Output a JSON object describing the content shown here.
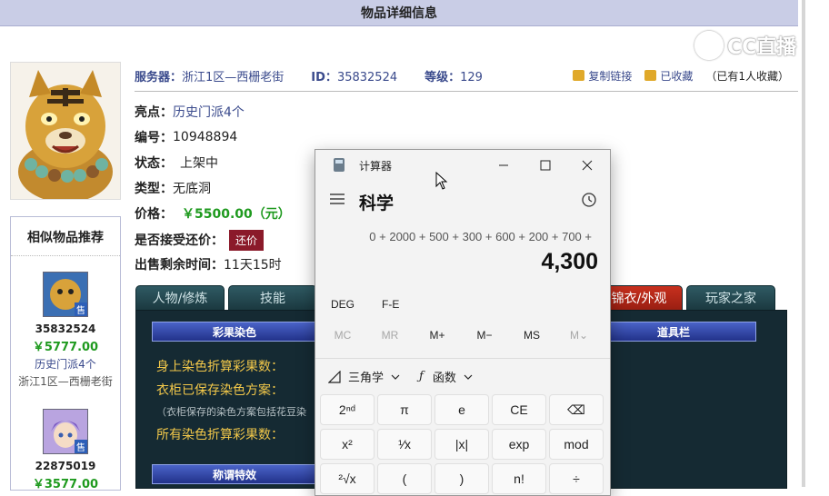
{
  "page": {
    "header_title": "物品详细信息",
    "watermark": "CC直播",
    "info_bar": {
      "server_label": "服务器：",
      "server_value": "浙江1区—西栅老街",
      "id_label": "ID：",
      "id_value": "35832524",
      "level_label": "等级：",
      "level_value": "129",
      "copy_link": "复制链接",
      "favorited": "已收藏",
      "favorite_count": "（已有1人收藏）"
    },
    "details": {
      "highlight_label": "亮点：",
      "highlight_value": "历史门派4个",
      "number_label": "编号：",
      "number_value": "10948894",
      "status_label": "状态：",
      "status_value": "上架中",
      "type_label": "类型：",
      "type_value": "无底洞",
      "price_label": "价格：",
      "price_value": "￥5500.00（元）",
      "bargain_label": "是否接受还价：",
      "bargain_button": "还价",
      "remaining_label": "出售剩余时间：",
      "remaining_value": "11天15时"
    },
    "sidebar": {
      "title": "相似物品推荐",
      "items": [
        {
          "id": "35832524",
          "price": "￥5777.00",
          "server": "历史门派4个",
          "server2": "浙江1区—西栅老街",
          "badge": "售"
        },
        {
          "id": "22875019",
          "price": "￥3577.00",
          "badge": "售"
        }
      ]
    },
    "tabs": [
      "人物/修炼",
      "技能",
      "锦衣/外观",
      "玩家之家"
    ],
    "panel": {
      "bar1": "彩果染色",
      "bar2": "道具栏",
      "bar3": "称谓特效",
      "line1": "身上染色折算彩果数：",
      "line2": "衣柜已保存染色方案：",
      "line3": "（衣柜保存的染色方案包括花豆染",
      "line4": "所有染色折算彩果数："
    }
  },
  "calculator": {
    "app_title": "计算器",
    "mode": "科学",
    "expression": "0 + 2000 + 500 + 300 + 600 + 200 + 700 +",
    "result": "4,300",
    "angle_unit": "DEG",
    "notation": "F-E",
    "memory": [
      "MC",
      "MR",
      "M+",
      "M−",
      "MS",
      "M⌄"
    ],
    "trig_label": "三角学",
    "func_label": "函数",
    "keys_row1": [
      "2ⁿᵈ",
      "π",
      "e",
      "CE",
      "⌫"
    ],
    "keys_row2": [
      "x²",
      "¹⁄x",
      "|x|",
      "exp",
      "mod"
    ],
    "keys_row3": [
      "²√x",
      "(",
      ")",
      "n!",
      "÷"
    ]
  },
  "colors": {
    "header_bg": "#c9cde6",
    "link_blue": "#3a4a8c",
    "price_green": "#1f9a1f",
    "tab_active": "#c8301e",
    "panel_bg": "#152a33",
    "gold_text": "#f2c84a"
  }
}
